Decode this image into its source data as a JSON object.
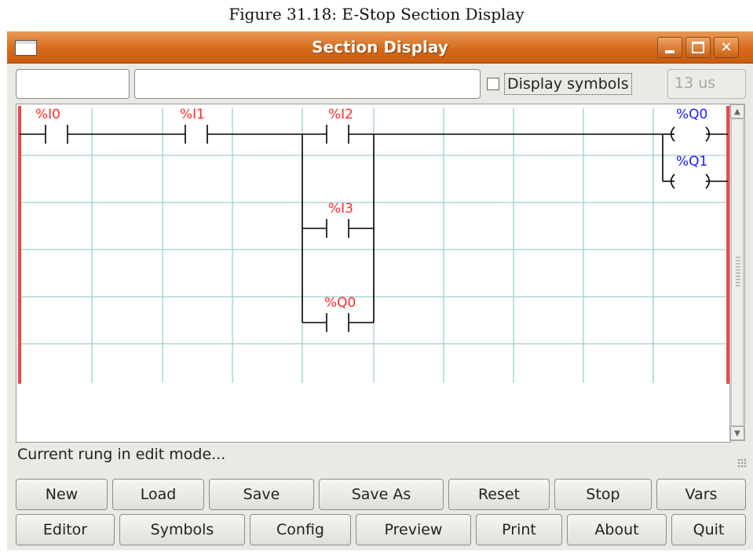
{
  "caption": "Figure 31.18: E-Stop Section Display",
  "window": {
    "title": "Section Display"
  },
  "toolbar": {
    "field1_value": "",
    "field2_value": "",
    "display_symbols_label": "Display symbols",
    "display_symbols_checked": false,
    "cycle_time": "13 us"
  },
  "ladder": {
    "contacts": [
      {
        "label": "%I0"
      },
      {
        "label": "%I1"
      },
      {
        "label": "%I2"
      },
      {
        "label": "%I3"
      },
      {
        "label": "%Q0"
      }
    ],
    "coils": [
      {
        "label": "%Q0"
      },
      {
        "label": "%Q1"
      }
    ],
    "colors": {
      "contact_label": "#ff2a2a",
      "coil_label": "#1a1aff",
      "grid": "#9fcfd0",
      "rail": "#e84a4a",
      "wire": "#000000"
    }
  },
  "status": "Current rung in edit mode...",
  "buttons_row1": [
    "New",
    "Load",
    "Save",
    "Save As",
    "Reset",
    "Stop",
    "Vars"
  ],
  "buttons_row2": [
    "Editor",
    "Symbols",
    "Config",
    "Preview",
    "Print",
    "About",
    "Quit"
  ]
}
